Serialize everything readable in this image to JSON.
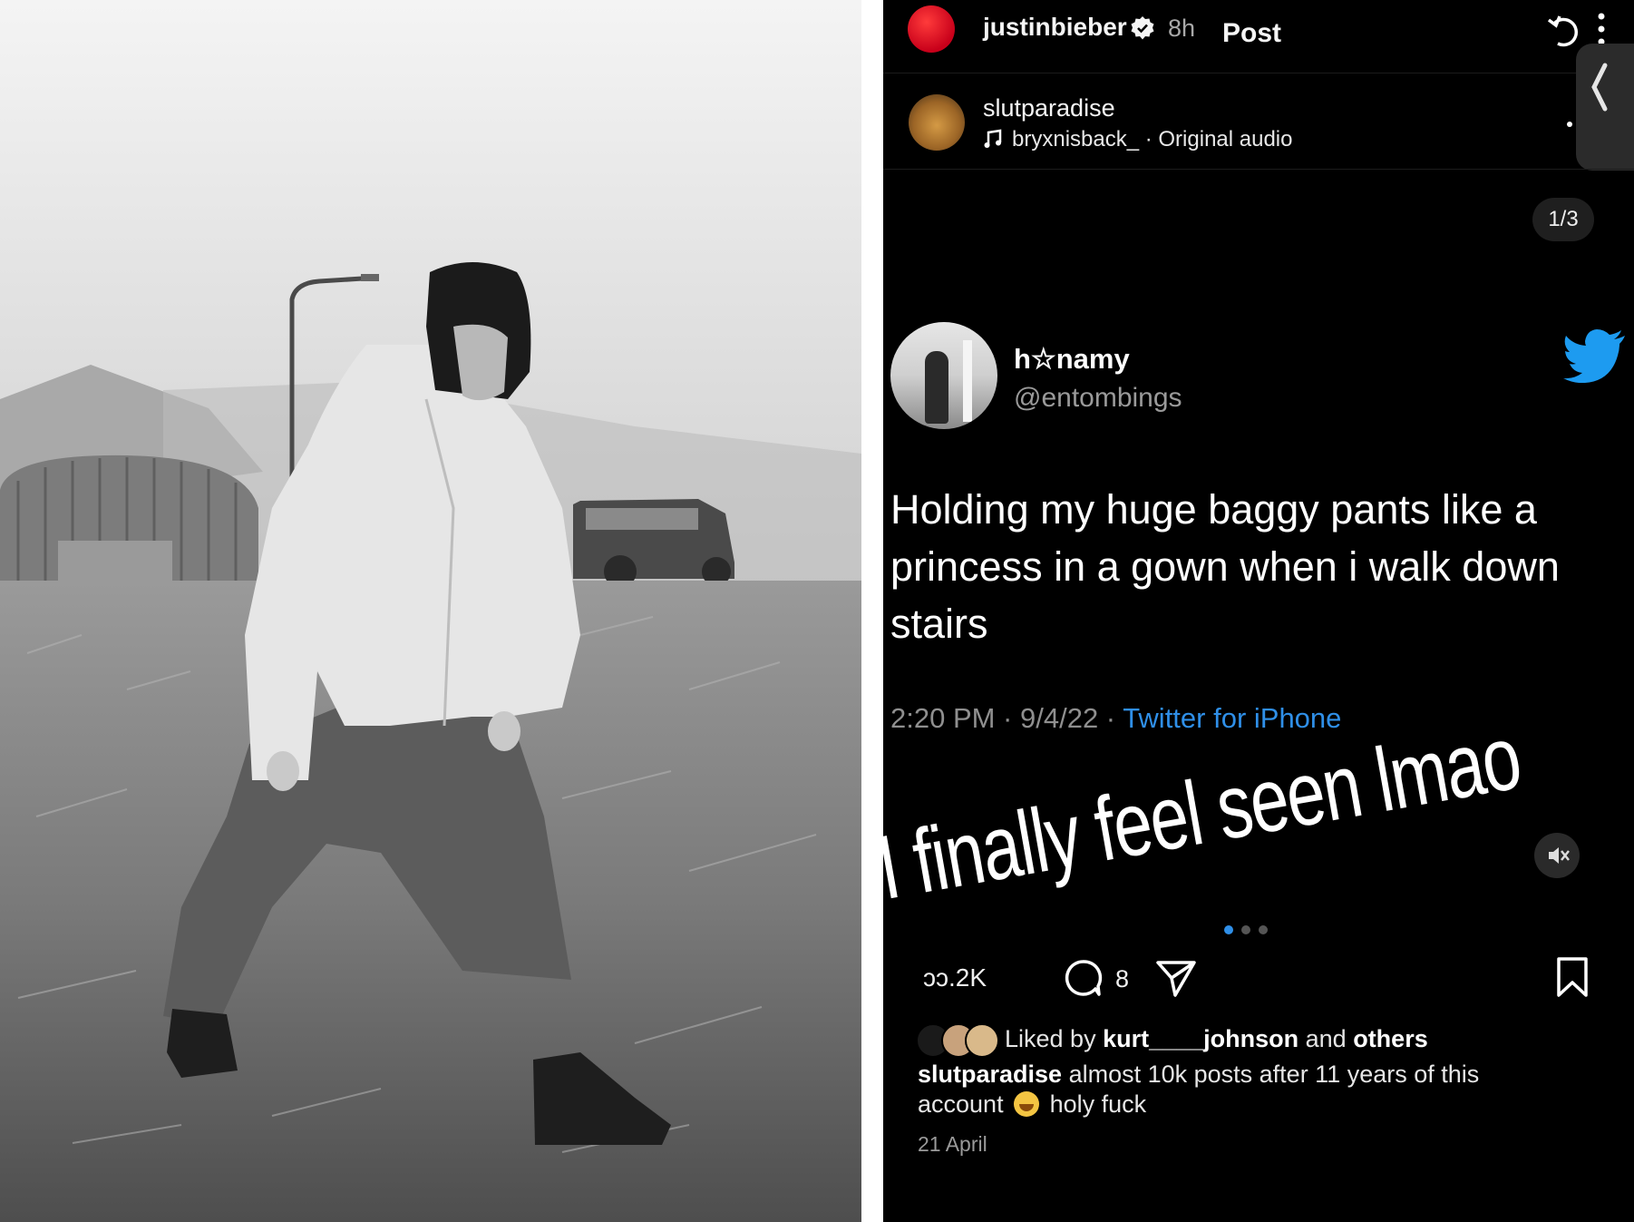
{
  "post": {
    "author": "justinbieber",
    "time": "8h",
    "label": "Post"
  },
  "reel": {
    "username": "slutparadise",
    "audio": "bryxnisback_ · Original audio",
    "counter": "1/3"
  },
  "tweet": {
    "name": "h☆namy",
    "handle": "@entombings",
    "text": "Holding my huge baggy pants like a princess in a gown when i walk down stairs",
    "timestamp": "2:20 PM · 9/4/22 · ",
    "source": "Twitter for iPhone"
  },
  "overlay": {
    "text": "I finally feel seen lmao"
  },
  "actions": {
    "likes": "ɔɔ.2K",
    "comments": "8"
  },
  "likes_line": {
    "prefix": "Liked by ",
    "user": "kurt____johnson",
    "middle": " and ",
    "others": "others"
  },
  "caption": {
    "user": "slutparadise",
    "text_before": " almost 10k posts after 11 years of this account ",
    "text_after": " holy fuck"
  },
  "date": "21 April",
  "colors": {
    "accent_blue": "#2f8fe8",
    "story_ring": "#e0001f",
    "twitter_blue": "#1d9bf0"
  },
  "icons": [
    "verified-icon",
    "refresh-icon",
    "more-icon",
    "chevron-left-icon",
    "music-icon",
    "twitter-icon",
    "mute-icon",
    "comment-icon",
    "share-icon",
    "save-icon",
    "crying-emoji-icon"
  ]
}
